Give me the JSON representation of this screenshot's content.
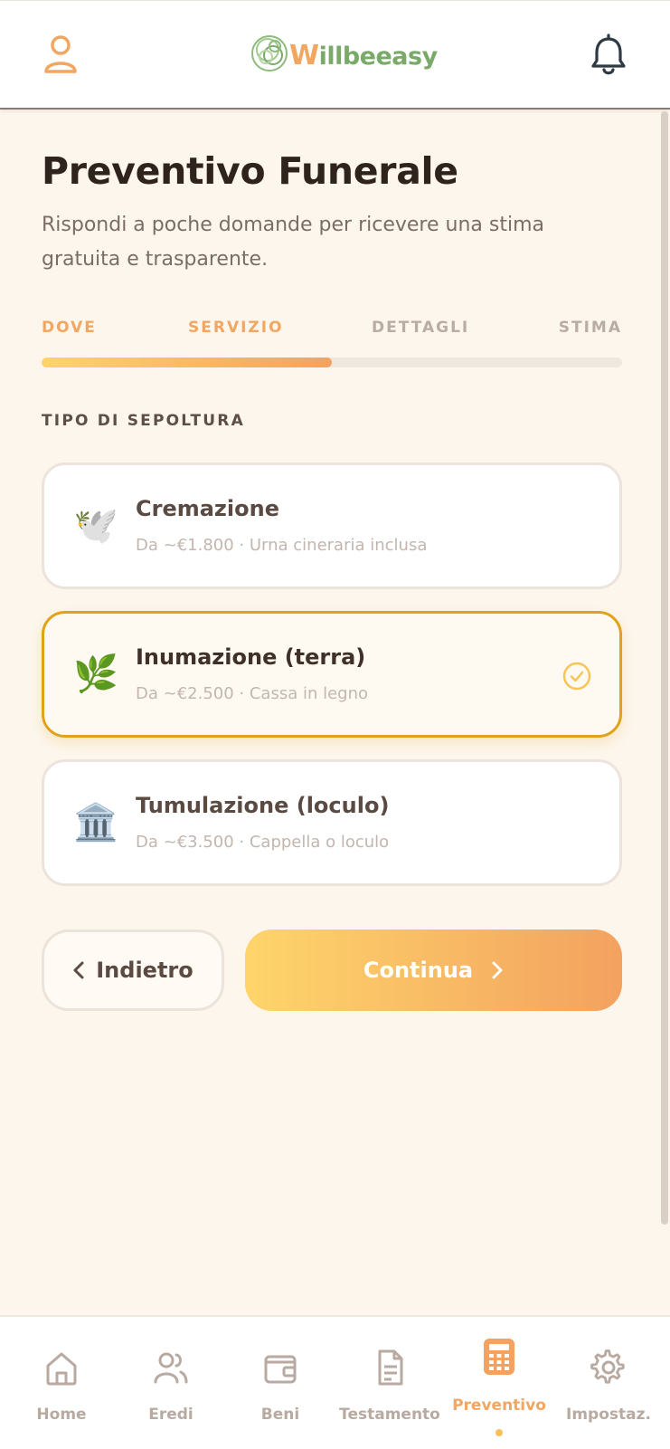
{
  "header": {
    "brand": {
      "w": "W",
      "rest": "illbeeasy"
    },
    "user_icon": "user-icon",
    "bell_icon": "bell-icon"
  },
  "page": {
    "title": "Preventivo Funerale",
    "subtitle": "Rispondi a poche domande per ricevere una stima gratuita e trasparente."
  },
  "steps": [
    {
      "label": "DOVE",
      "state": "done"
    },
    {
      "label": "SERVIZIO",
      "state": "current"
    },
    {
      "label": "DETTAGLI",
      "state": "todo"
    },
    {
      "label": "STIMA",
      "state": "todo"
    }
  ],
  "progress": 0.5,
  "section_label": "TIPO DI SEPOLTURA",
  "options": [
    {
      "emoji": "🕊️",
      "title": "Cremazione",
      "desc": "Da ~€1.800 · Urna cineraria inclusa",
      "selected": false
    },
    {
      "emoji": "🌿",
      "title": "Inumazione (terra)",
      "desc": "Da ~€2.500 · Cassa in legno",
      "selected": true
    },
    {
      "emoji": "🏛️",
      "title": "Tumulazione (loculo)",
      "desc": "Da ~€3.500 · Cappella o loculo",
      "selected": false
    }
  ],
  "buttons": {
    "back": "Indietro",
    "continue": "Continua"
  },
  "nav": [
    {
      "label": "Home",
      "icon": "home-icon",
      "active": false
    },
    {
      "label": "Eredi",
      "icon": "users-icon",
      "active": false
    },
    {
      "label": "Beni",
      "icon": "wallet-icon",
      "active": false
    },
    {
      "label": "Testamento",
      "icon": "document-icon",
      "active": false
    },
    {
      "label": "Preventivo",
      "icon": "calculator-icon",
      "active": true
    },
    {
      "label": "Impostaz.",
      "icon": "gear-icon",
      "active": false
    }
  ],
  "colors": {
    "accent": "#f1a661",
    "selected_border": "#e0a21b",
    "brand_green": "#7aaa6a",
    "background": "#fdf6ec"
  }
}
